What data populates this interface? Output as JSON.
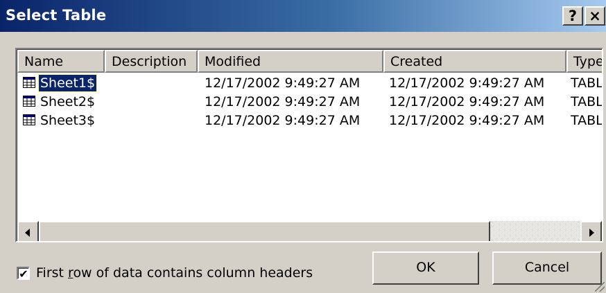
{
  "window": {
    "title": "Select Table",
    "help_label": "?",
    "close_label": "×"
  },
  "list": {
    "columns": [
      "Name",
      "Description",
      "Modified",
      "Created",
      "Type"
    ],
    "rows": [
      {
        "name": "Sheet1$",
        "description": "",
        "modified": "12/17/2002 9:49:27 AM",
        "created": "12/17/2002 9:49:27 AM",
        "type": "TABLE",
        "selected": true
      },
      {
        "name": "Sheet2$",
        "description": "",
        "modified": "12/17/2002 9:49:27 AM",
        "created": "12/17/2002 9:49:27 AM",
        "type": "TABLE",
        "selected": false
      },
      {
        "name": "Sheet3$",
        "description": "",
        "modified": "12/17/2002 9:49:27 AM",
        "created": "12/17/2002 9:49:27 AM",
        "type": "TABLE",
        "selected": false
      }
    ]
  },
  "options": {
    "first_row_headers_label_pre": "First ",
    "first_row_headers_label_accel": "r",
    "first_row_headers_label_post": "ow of data contains column headers",
    "first_row_headers_checked": true
  },
  "buttons": {
    "ok": "OK",
    "cancel": "Cancel"
  },
  "colors": {
    "title_gradient_start": "#0a246a",
    "title_gradient_end": "#a6caf0",
    "selection": "#0a246a",
    "face": "#d4d0c8"
  }
}
